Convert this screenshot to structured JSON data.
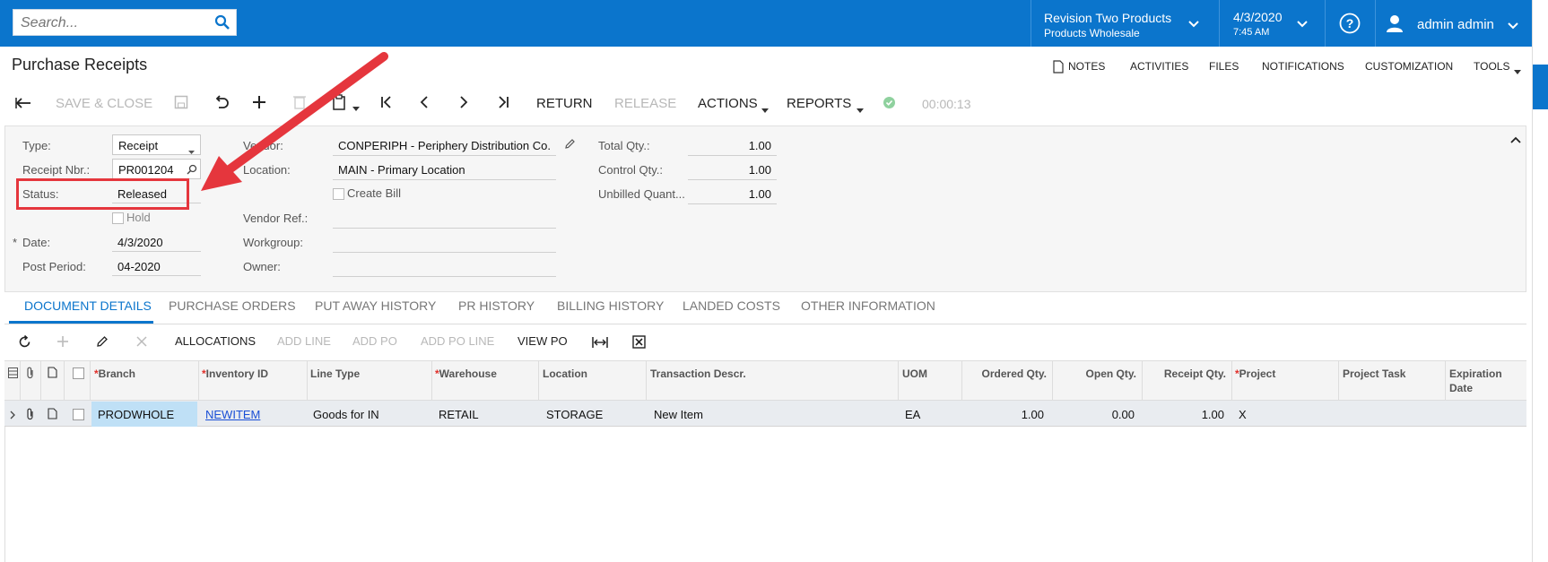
{
  "topbar": {
    "search_placeholder": "Search...",
    "company_name": "Revision Two Products",
    "company_branch": "Products Wholesale",
    "date": "4/3/2020",
    "time": "7:45 AM",
    "user": "admin admin"
  },
  "page": {
    "title": "Purchase Receipts",
    "links": [
      "NOTES",
      "ACTIVITIES",
      "FILES",
      "NOTIFICATIONS",
      "CUSTOMIZATION",
      "TOOLS"
    ]
  },
  "toolbar": {
    "save_close": "SAVE & CLOSE",
    "return": "RETURN",
    "release": "RELEASE",
    "actions": "ACTIONS",
    "reports": "REPORTS",
    "timer": "00:00:13"
  },
  "form": {
    "type_label": "Type:",
    "type_value": "Receipt",
    "receipt_nbr_label": "Receipt Nbr.:",
    "receipt_nbr_value": "PR001204",
    "status_label": "Status:",
    "status_value": "Released",
    "hold_label": "Hold",
    "date_label": "Date:",
    "date_value": "4/3/2020",
    "post_period_label": "Post Period:",
    "post_period_value": "04-2020",
    "vendor_label": "Vendor:",
    "vendor_value": "CONPERIPH - Periphery Distribution Co.",
    "location_label": "Location:",
    "location_value": "MAIN - Primary Location",
    "create_bill_label": "Create Bill",
    "vendor_ref_label": "Vendor Ref.:",
    "workgroup_label": "Workgroup:",
    "owner_label": "Owner:",
    "total_qty_label": "Total Qty.:",
    "total_qty_value": "1.00",
    "control_qty_label": "Control Qty.:",
    "control_qty_value": "1.00",
    "unbilled_label": "Unbilled Quant...",
    "unbilled_value": "1.00"
  },
  "tabs": [
    "DOCUMENT DETAILS",
    "PURCHASE ORDERS",
    "PUT AWAY HISTORY",
    "PR HISTORY",
    "BILLING HISTORY",
    "LANDED COSTS",
    "OTHER INFORMATION"
  ],
  "grid_toolbar": {
    "allocations": "ALLOCATIONS",
    "add_line": "ADD LINE",
    "add_po": "ADD PO",
    "add_po_line": "ADD PO LINE",
    "view_po": "VIEW PO"
  },
  "grid": {
    "columns": [
      "Branch",
      "Inventory ID",
      "Line Type",
      "Warehouse",
      "Location",
      "Transaction Descr.",
      "UOM",
      "Ordered Qty.",
      "Open Qty.",
      "Receipt Qty.",
      "Project",
      "Project Task",
      "Expiration Date"
    ],
    "rows": [
      {
        "branch": "PRODWHOLE",
        "inventory_id": "NEWITEM",
        "line_type": "Goods for IN",
        "warehouse": "RETAIL",
        "location": "STORAGE",
        "descr": "New Item",
        "uom": "EA",
        "ordered_qty": "1.00",
        "open_qty": "0.00",
        "receipt_qty": "1.00",
        "project": "X",
        "project_task": "",
        "expiration_date": ""
      }
    ]
  },
  "colors": {
    "brand_blue": "#0b75cc",
    "annotation_red": "#e5363d",
    "selected_cell": "#bfe0f6"
  }
}
